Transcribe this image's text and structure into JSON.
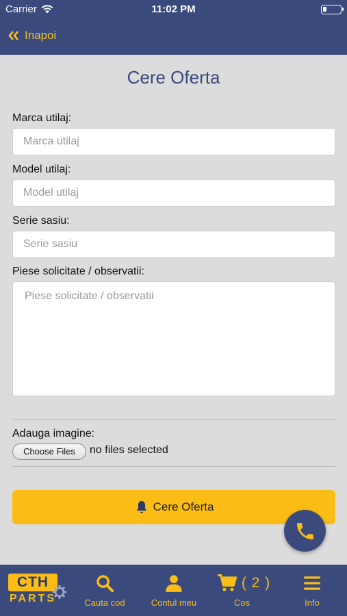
{
  "status_bar": {
    "carrier": "Carrier",
    "time": "11:02 PM"
  },
  "nav": {
    "back_label": "Inapoi"
  },
  "page_title": "Cere Oferta",
  "form": {
    "brand_label": "Marca utilaj:",
    "brand_placeholder": "Marca utilaj",
    "model_label": "Model utilaj:",
    "model_placeholder": "Model utilaj",
    "serial_label": "Serie sasiu:",
    "serial_placeholder": "Serie sasiu",
    "parts_label": "Piese solicitate / observatii:",
    "parts_placeholder": "Piese solicitate / observatii",
    "image_label": "Adauga imagine:",
    "choose_files_label": "Choose Files",
    "file_status": "no files selected",
    "submit_label": "Cere Oferta"
  },
  "tabbar": {
    "logo_top": "CTH",
    "logo_bottom": "PARTS",
    "search_label": "Cauta cod",
    "account_label": "Contul meu",
    "cart_label": "Cos",
    "cart_count": "( 2 )",
    "info_label": "Info"
  },
  "colors": {
    "brand_navy": "#3a4a7c",
    "accent_yellow": "#fbbd15",
    "background": "#dcdcdc"
  },
  "icons": [
    "wifi-icon",
    "battery-icon",
    "double-chevron-left-icon",
    "bell-icon",
    "phone-icon",
    "search-icon",
    "user-icon",
    "cart-icon",
    "menu-icon"
  ]
}
